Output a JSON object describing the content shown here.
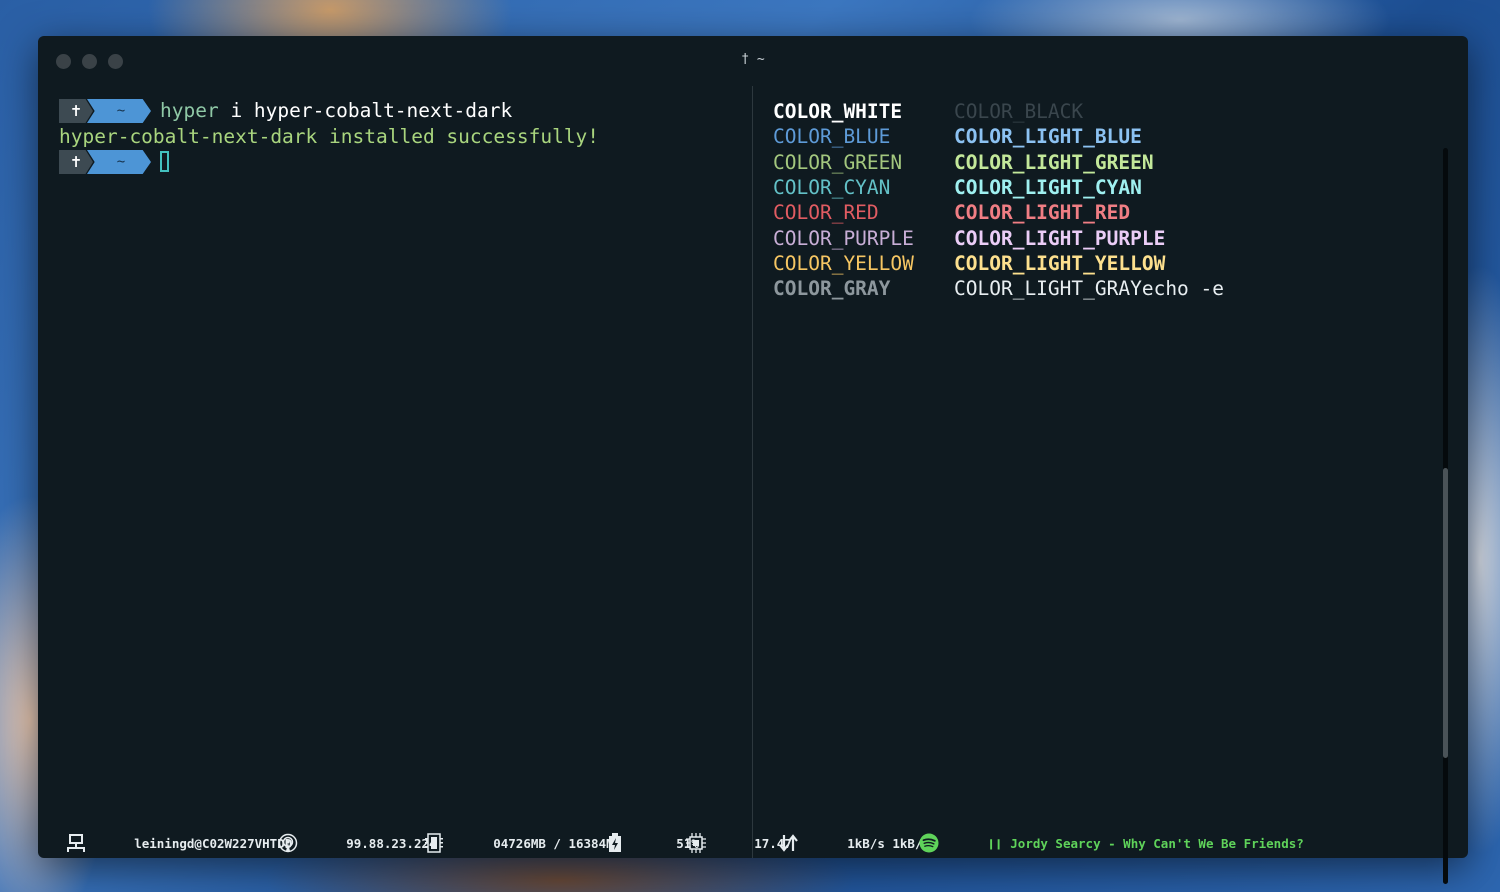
{
  "window": {
    "title": "† ~"
  },
  "left_pane": {
    "prompt": {
      "cross": "✝",
      "dir": "~"
    },
    "command_part1": "hyper",
    "command_part2": " i hyper-cobalt-next-dark",
    "output": "hyper-cobalt-next-dark installed successfully!"
  },
  "right_pane": {
    "rows": [
      {
        "left": {
          "text": "COLOR_WHITE",
          "color": "#ffffff",
          "bold": true
        },
        "right": {
          "text": "COLOR_BLACK",
          "color": "#3a464d",
          "bold": false
        }
      },
      {
        "left": {
          "text": "COLOR_BLUE",
          "color": "#5e9bd8",
          "bold": false
        },
        "right": {
          "text": "COLOR_LIGHT_BLUE",
          "color": "#8cc2f2",
          "bold": true
        }
      },
      {
        "left": {
          "text": "COLOR_GREEN",
          "color": "#a3c77e",
          "bold": false
        },
        "right": {
          "text": "COLOR_LIGHT_GREEN",
          "color": "#c3e89a",
          "bold": true
        }
      },
      {
        "left": {
          "text": "COLOR_CYAN",
          "color": "#63c1c7",
          "bold": false
        },
        "right": {
          "text": "COLOR_LIGHT_CYAN",
          "color": "#9ff0f0",
          "bold": true
        }
      },
      {
        "left": {
          "text": "COLOR_RED",
          "color": "#e15c62",
          "bold": false
        },
        "right": {
          "text": "COLOR_LIGHT_RED",
          "color": "#f07e84",
          "bold": true
        }
      },
      {
        "left": {
          "text": "COLOR_PURPLE",
          "color": "#c8aed6",
          "bold": false
        },
        "right": {
          "text": "COLOR_LIGHT_PURPLE",
          "color": "#ebcdf7",
          "bold": true
        }
      },
      {
        "left": {
          "text": "COLOR_YELLOW",
          "color": "#f6c663",
          "bold": false
        },
        "right": {
          "text": "COLOR_LIGHT_YELLOW",
          "color": "#fde08e",
          "bold": true
        }
      },
      {
        "left": {
          "text": "COLOR_GRAY",
          "color": "#8d979d",
          "bold": true
        },
        "right": {
          "text": "COLOR_LIGHT_GRAYecho -e",
          "color": "#e8eef1",
          "bold": false
        }
      }
    ]
  },
  "statusbar": {
    "host": "leiningd@C02W227VHTDD",
    "ip": "99.88.23.224",
    "memory": "04726MB / 16384MB",
    "battery": "51%",
    "cpu": "17.47",
    "network": "1kB/s 1kB/s",
    "spotify_state": "❙❙",
    "spotify_track": "Jordy Searcy - Why Can't We Be Friends?"
  },
  "colors": {
    "window_bg": "#0f1a20",
    "prompt_seg1": "#3d4a52",
    "prompt_seg2": "#4d95d6",
    "success_text": "#a9d57e",
    "cursor": "#43c1bf",
    "spotify_green": "#5fd35a"
  }
}
